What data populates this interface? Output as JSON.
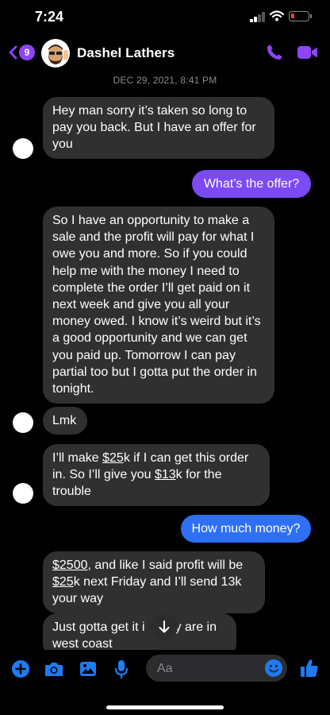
{
  "status_bar": {
    "time": "7:24",
    "battery_level": 0.2
  },
  "header": {
    "back_badge": "9",
    "contact_name": "Dashel Lathers"
  },
  "conversation": {
    "timestamp": "DEC 29, 2021, 8:41 PM",
    "messages": [
      {
        "from": "them",
        "text": "Hey man sorry it’s taken so long to pay you back. But I have an offer for you"
      },
      {
        "from": "me",
        "text": "What’s the offer?"
      },
      {
        "from": "them",
        "text": "So I have an opportunity to make a sale and the profit will pay for what I owe you and more. So if you could help me with the money I need to complete the order I’ll get paid on it next week and give you all your money owed. I know it’s weird but it’s a good opportunity and we can get you paid up. Tomorrow I can pay partial too but I gotta put the order in tonight."
      },
      {
        "from": "them",
        "text": "Lmk"
      },
      {
        "from": "them",
        "parts": [
          "I’ll make ",
          "$25",
          "k if I can get this order in. So I’ll give you ",
          "$13",
          "k for the trouble"
        ]
      },
      {
        "from": "me",
        "text": "How much money?"
      },
      {
        "from": "them",
        "parts": [
          "$2500",
          ", and like I said profit will be ",
          "$25",
          "k next Friday and I’ll send 13k your way"
        ]
      },
      {
        "from": "them",
        "parts": [
          "Just gotta get it i",
          "y are in west coast"
        ]
      }
    ]
  },
  "composer": {
    "placeholder": "Aa"
  },
  "colors": {
    "accent": "#8e44f7",
    "bubble_in": "#303030",
    "sent_gradient_top": "#7b4af3",
    "sent_gradient_bottom": "#2f6ff5",
    "icon_blue": "#1e7bf2"
  },
  "icons": [
    "back-chevron-icon",
    "phone-icon",
    "video-camera-icon",
    "plus-icon",
    "camera-icon",
    "image-icon",
    "microphone-icon",
    "emoji-icon",
    "thumbs-up-icon",
    "arrow-down-icon"
  ]
}
